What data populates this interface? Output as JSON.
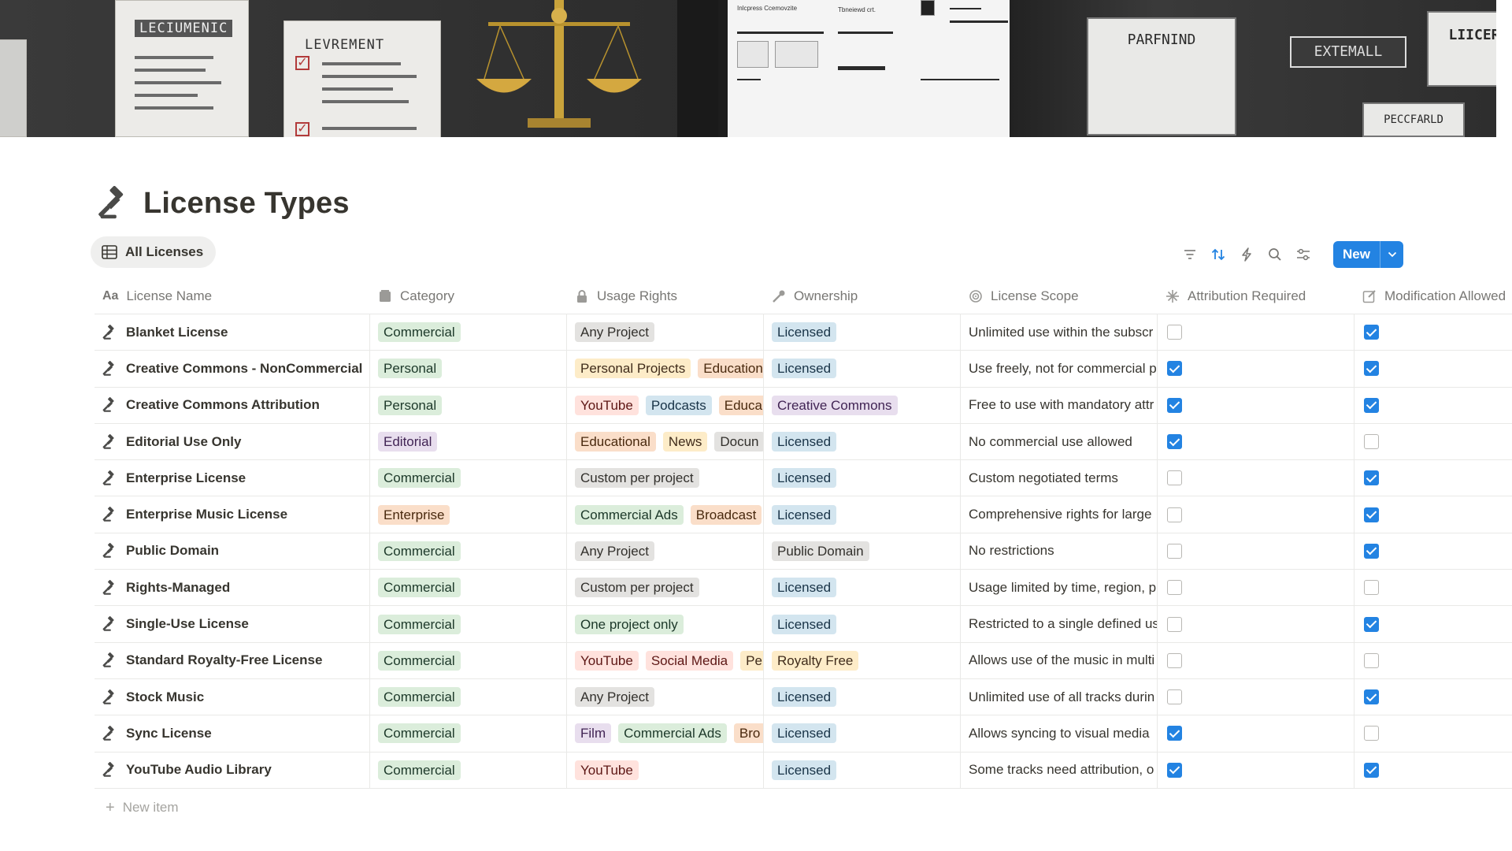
{
  "cover": {
    "doc1_title": "LECIUMENIC",
    "doc2_title": "LEVREMENT",
    "sign1": "PARFNIND",
    "sign2": "EXTEMALL",
    "sign3": "LIICER",
    "sign4": "PECCFARLD",
    "screen_text_1": "Inlcpress Ccemovzite",
    "screen_text_2": "Tbneiewd crt."
  },
  "page": {
    "title": "License Types",
    "title_icon": "gavel-icon"
  },
  "view": {
    "tab_label": "All Licenses"
  },
  "toolbar": {
    "new_label": "New",
    "accent": "#2383e2"
  },
  "table": {
    "columns": [
      {
        "label": "License Name",
        "icon": "text-type-icon"
      },
      {
        "label": "Category",
        "icon": "folder-icon"
      },
      {
        "label": "Usage Rights",
        "icon": "lock-icon"
      },
      {
        "label": "Ownership",
        "icon": "key-icon"
      },
      {
        "label": "License Scope",
        "icon": "target-icon"
      },
      {
        "label": "Attribution Required",
        "icon": "sparkle-icon"
      },
      {
        "label": "Modification Allowed",
        "icon": "edit-icon"
      }
    ],
    "rows": [
      {
        "name": "Blanket License",
        "category": "Commercial",
        "usage": [
          "Any Project"
        ],
        "ownership": "Licensed",
        "scope": "Unlimited use within the subscr",
        "attribution": false,
        "modification": true
      },
      {
        "name": "Creative Commons - NonCommercial",
        "category": "Personal",
        "usage": [
          "Personal Projects",
          "Education"
        ],
        "ownership": "Licensed",
        "scope": "Use freely, not for commercial p",
        "attribution": true,
        "modification": true
      },
      {
        "name": "Creative Commons Attribution",
        "category": "Personal",
        "usage": [
          "YouTube",
          "Podcasts",
          "Educa"
        ],
        "ownership": "Creative Commons",
        "scope": "Free to use with mandatory attr",
        "attribution": true,
        "modification": true
      },
      {
        "name": "Editorial Use Only",
        "category": "Editorial",
        "usage": [
          "Educational",
          "News",
          "Docun"
        ],
        "ownership": "Licensed",
        "scope": "No commercial use allowed",
        "attribution": true,
        "modification": false
      },
      {
        "name": "Enterprise License",
        "category": "Commercial",
        "usage": [
          "Custom per project"
        ],
        "ownership": "Licensed",
        "scope": "Custom negotiated terms",
        "attribution": false,
        "modification": true
      },
      {
        "name": "Enterprise Music License",
        "category": "Enterprise",
        "usage": [
          "Commercial Ads",
          "Broadcast"
        ],
        "ownership": "Licensed",
        "scope": "Comprehensive rights for large",
        "attribution": false,
        "modification": true
      },
      {
        "name": "Public Domain",
        "category": "Commercial",
        "usage": [
          "Any Project"
        ],
        "ownership": "Public Domain",
        "scope": "No restrictions",
        "attribution": false,
        "modification": true
      },
      {
        "name": "Rights-Managed",
        "category": "Commercial",
        "usage": [
          "Custom per project"
        ],
        "ownership": "Licensed",
        "scope": "Usage limited by time, region, p",
        "attribution": false,
        "modification": false
      },
      {
        "name": "Single-Use License",
        "category": "Commercial",
        "usage": [
          "One project only"
        ],
        "ownership": "Licensed",
        "scope": "Restricted to a single defined us",
        "attribution": false,
        "modification": true
      },
      {
        "name": "Standard Royalty-Free License",
        "category": "Commercial",
        "usage": [
          "YouTube",
          "Social Media",
          "Pe"
        ],
        "ownership": "Royalty Free",
        "scope": "Allows use of the music in multi",
        "attribution": false,
        "modification": false
      },
      {
        "name": "Stock Music",
        "category": "Commercial",
        "usage": [
          "Any Project"
        ],
        "ownership": "Licensed",
        "scope": "Unlimited use of all tracks durin",
        "attribution": false,
        "modification": true
      },
      {
        "name": "Sync License",
        "category": "Commercial",
        "usage": [
          "Film",
          "Commercial Ads",
          "Bro"
        ],
        "ownership": "Licensed",
        "scope": "Allows syncing to visual media",
        "attribution": true,
        "modification": false
      },
      {
        "name": "YouTube Audio Library",
        "category": "Commercial",
        "usage": [
          "YouTube"
        ],
        "ownership": "Licensed",
        "scope": "Some tracks need attribution, o",
        "attribution": true,
        "modification": true
      }
    ],
    "new_item_label": "New item"
  },
  "tag_colors": {
    "Commercial": [
      "#dbeddb",
      "#1c3829"
    ],
    "Personal": [
      "#dbeddb",
      "#1c3829"
    ],
    "Editorial": [
      "#e8deee",
      "#412454"
    ],
    "Enterprise": [
      "#fadec9",
      "#49290e"
    ],
    "Any Project": [
      "#e3e2e0",
      "#32302c"
    ],
    "Personal Projects": [
      "#fdecc8",
      "#402c1b"
    ],
    "Education": [
      "#fadec9",
      "#49290e"
    ],
    "YouTube": [
      "#ffe2dd",
      "#5d1715"
    ],
    "Podcasts": [
      "#d3e5ef",
      "#183347"
    ],
    "Educa": [
      "#fadec9",
      "#49290e"
    ],
    "Educational": [
      "#fadec9",
      "#49290e"
    ],
    "News": [
      "#fdecc8",
      "#402c1b"
    ],
    "Docun": [
      "#e3e2e0",
      "#32302c"
    ],
    "Custom per project": [
      "#e3e2e0",
      "#32302c"
    ],
    "Commercial Ads": [
      "#dbeddb",
      "#1c3829"
    ],
    "Broadcast": [
      "#fadec9",
      "#49290e"
    ],
    "One project only": [
      "#dbeddb",
      "#1c3829"
    ],
    "Social Media": [
      "#ffe2dd",
      "#5d1715"
    ],
    "Pe": [
      "#fdecc8",
      "#402c1b"
    ],
    "Film": [
      "#e8deee",
      "#412454"
    ],
    "Bro": [
      "#fadec9",
      "#49290e"
    ],
    "Licensed": [
      "#d3e5ef",
      "#183347"
    ],
    "Creative Commons": [
      "#e8deee",
      "#412454"
    ],
    "Public Domain": [
      "#e3e2e0",
      "#32302c"
    ],
    "Royalty Free": [
      "#fdecc8",
      "#402c1b"
    ]
  }
}
